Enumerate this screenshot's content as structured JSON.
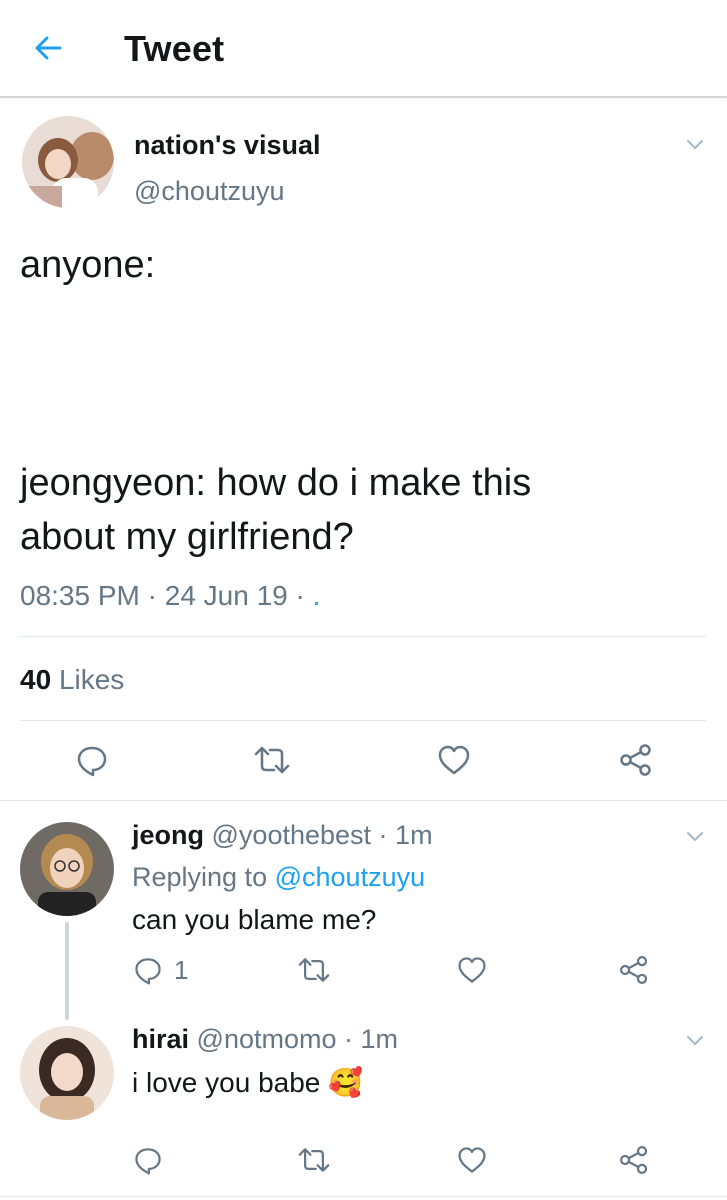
{
  "header": {
    "title": "Tweet"
  },
  "tweet": {
    "name": "nation's visual",
    "handle": "@choutzuyu",
    "text_line1": "anyone:",
    "text_line2": "jeongyeon: how do i make this",
    "text_line3": "about my girlfriend?",
    "time": "08:35 PM",
    "date": "24 Jun 19",
    "likes_count": "40",
    "likes_label": "Likes"
  },
  "replies": [
    {
      "name": "jeong",
      "handle": "@yoothebest",
      "time": "1m",
      "replying_label": "Replying to",
      "replying_handle": "@choutzuyu",
      "text": "can you blame me?",
      "reply_count": "1"
    },
    {
      "name": "hirai",
      "handle": "@notmomo",
      "time": "1m",
      "text": "i love you babe",
      "emoji": "🥰"
    }
  ],
  "colors": {
    "accent": "#1da1f2",
    "muted": "#657786",
    "divider": "#e1e8ed"
  },
  "icons": [
    "back-arrow-icon",
    "chevron-down-icon",
    "reply-icon",
    "retweet-icon",
    "like-icon",
    "share-icon"
  ]
}
